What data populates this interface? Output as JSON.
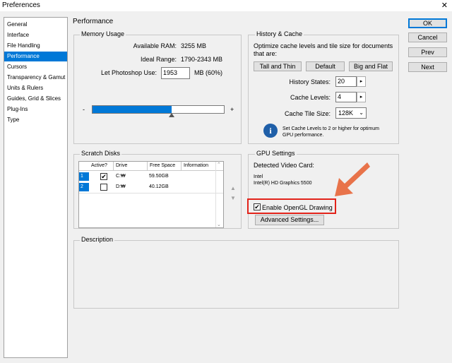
{
  "window": {
    "title": "Preferences"
  },
  "nav": {
    "items": [
      "General",
      "Interface",
      "File Handling",
      "Performance",
      "Cursors",
      "Transparency & Gamut",
      "Units & Rulers",
      "Guides, Grid & Slices",
      "Plug-Ins",
      "Type"
    ],
    "selected_index": 3
  },
  "buttons": {
    "ok": "OK",
    "cancel": "Cancel",
    "prev": "Prev",
    "next": "Next"
  },
  "page": {
    "title": "Performance"
  },
  "memory": {
    "legend": "Memory Usage",
    "available_label": "Available RAM:",
    "available_value": "3255 MB",
    "ideal_label": "Ideal Range:",
    "ideal_value": "1790-2343 MB",
    "let_label": "Let Photoshop Use:",
    "let_value": "1953",
    "let_suffix": "MB (60%)",
    "minus": "-",
    "plus": "+",
    "slider_fraction": 0.6
  },
  "history": {
    "legend": "History & Cache",
    "desc": "Optimize cache levels and tile size for documents that are:",
    "btn_tall": "Tall and Thin",
    "btn_default": "Default",
    "btn_big": "Big and Flat",
    "states_label": "History States:",
    "states_value": "20",
    "levels_label": "Cache Levels:",
    "levels_value": "4",
    "tile_label": "Cache Tile Size:",
    "tile_value": "128K",
    "info_icon_text": "i",
    "info": "Set Cache Levels to 2 or higher for optimum GPU performance."
  },
  "scratch": {
    "legend": "Scratch Disks",
    "columns": [
      "Active?",
      "Drive",
      "Free Space",
      "Information"
    ],
    "rows": [
      {
        "index": "1",
        "active": true,
        "drive": "C:₩",
        "free": "59.50GB",
        "info": ""
      },
      {
        "index": "2",
        "active": false,
        "drive": "D:₩",
        "free": "40.12GB",
        "info": ""
      }
    ],
    "check_mark": "✔",
    "up_arrow": "▲",
    "down_arrow": "▼"
  },
  "gpu": {
    "legend": "GPU Settings",
    "detected_label": "Detected Video Card:",
    "card_vendor": "Intel",
    "card_name": "Intel(R) HD Graphics 5500",
    "opengl_label": "Enable OpenGL Drawing",
    "opengl_checked": true,
    "advanced": "Advanced Settings..."
  },
  "description": {
    "legend": "Description"
  },
  "colors": {
    "accent": "#0078d7",
    "highlight": "#e2231a",
    "arrow": "#e8734a"
  }
}
